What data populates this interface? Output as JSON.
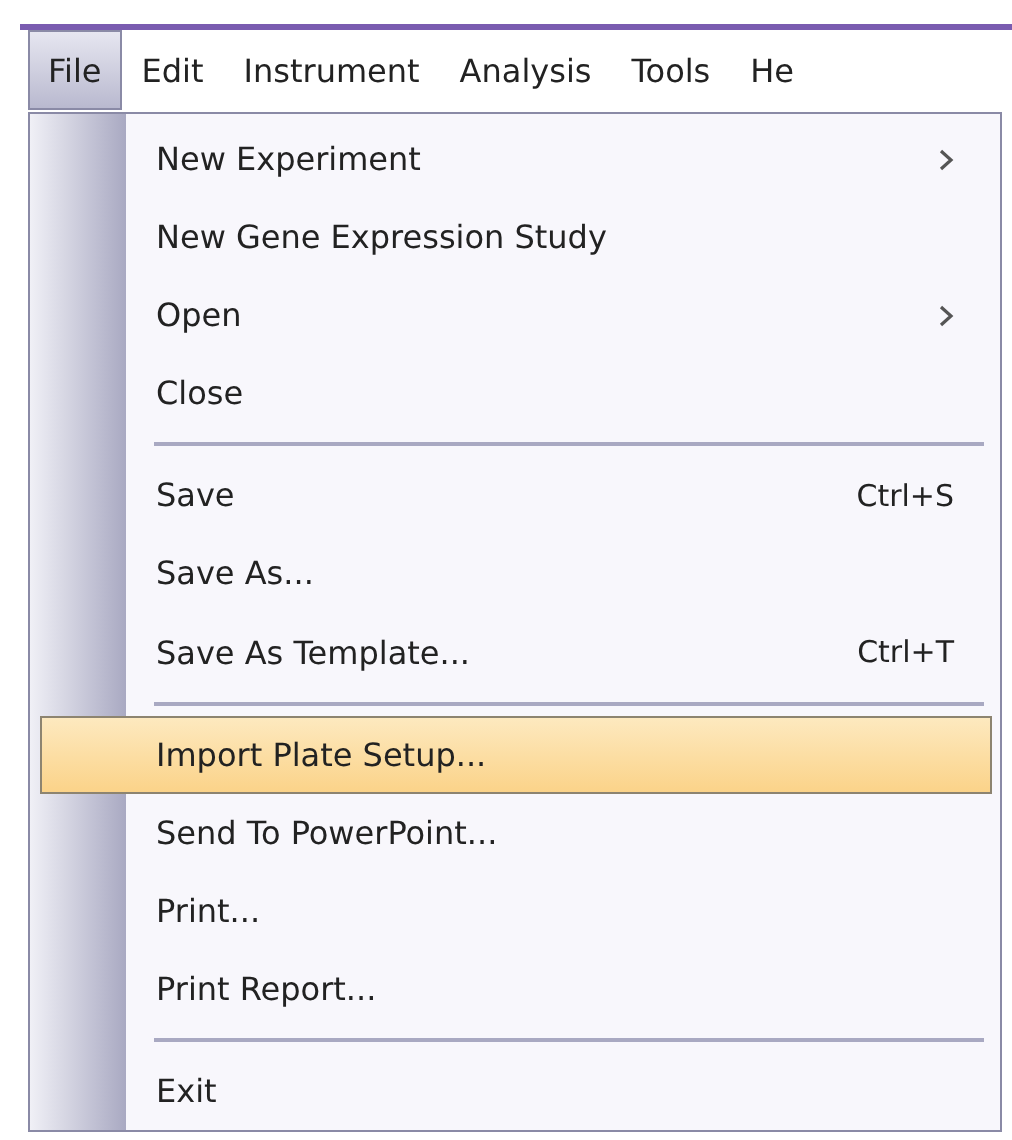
{
  "menu_bar": [
    {
      "label": "File",
      "selected": true
    },
    {
      "label": "Edit",
      "selected": false
    },
    {
      "label": "Instrument",
      "selected": false
    },
    {
      "label": "Analysis",
      "selected": false
    },
    {
      "label": "Tools",
      "selected": false
    },
    {
      "label": "He",
      "selected": false
    }
  ],
  "file_menu": [
    {
      "kind": "item",
      "label": "New Experiment",
      "submenu": true,
      "selected": false
    },
    {
      "kind": "item",
      "label": "New Gene Expression Study",
      "submenu": false,
      "selected": false
    },
    {
      "kind": "item",
      "label": "Open",
      "submenu": true,
      "selected": false
    },
    {
      "kind": "item",
      "label": "Close",
      "submenu": false,
      "selected": false
    },
    {
      "kind": "separator"
    },
    {
      "kind": "item",
      "label": "Save",
      "shortcut": "Ctrl+S",
      "submenu": false,
      "selected": false
    },
    {
      "kind": "item",
      "label": "Save As...",
      "submenu": false,
      "selected": false
    },
    {
      "kind": "item",
      "label": "Save As Template...",
      "shortcut": "Ctrl+T",
      "submenu": false,
      "selected": false
    },
    {
      "kind": "separator"
    },
    {
      "kind": "item",
      "label": "Import Plate Setup...",
      "submenu": false,
      "selected": true
    },
    {
      "kind": "item",
      "label": "Send To PowerPoint...",
      "submenu": false,
      "selected": false
    },
    {
      "kind": "item",
      "label": "Print...",
      "submenu": false,
      "selected": false
    },
    {
      "kind": "item",
      "label": "Print Report...",
      "submenu": false,
      "selected": false
    },
    {
      "kind": "separator"
    },
    {
      "kind": "item",
      "label": "Exit",
      "submenu": false,
      "selected": false
    }
  ]
}
